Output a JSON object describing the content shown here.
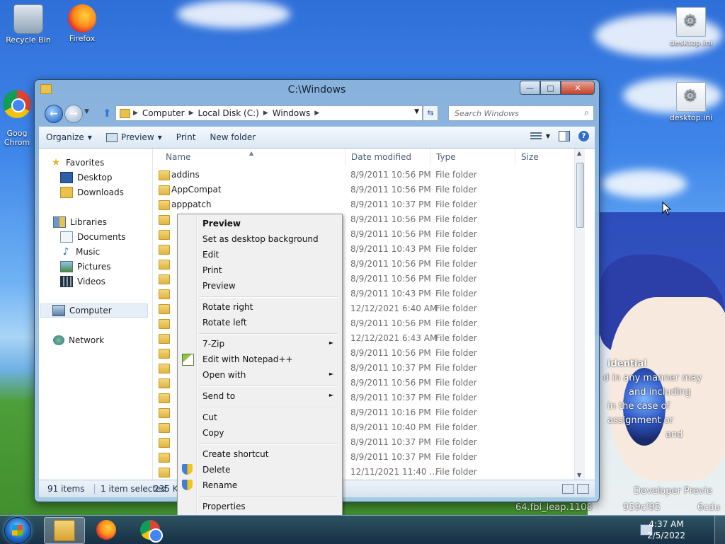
{
  "desktop": {
    "icons": [
      {
        "label": "Recycle Bin",
        "icon": "recycle-bin-icon"
      },
      {
        "label": "Firefox",
        "icon": "firefox-icon"
      },
      {
        "label": "Goog\nChrom",
        "icon": "chrome-icon"
      },
      {
        "label": "desktop.ini",
        "icon": "settings-file-icon"
      },
      {
        "label": "desktop.ini",
        "icon": "settings-file-icon"
      }
    ],
    "wallpaper_text": {
      "line1": "idential",
      "line2": "d in any manner may",
      "line3": "and including",
      "line4": "in the case of",
      "line5": "assignment or",
      "line6": "and",
      "preview": "Developer Previe",
      "build": "64.fbl_leap.1108",
      "build2": "959cf95",
      "build3": "6cdu"
    }
  },
  "window": {
    "title": "C:\\Windows",
    "caption_buttons": {
      "minimize": "—",
      "maximize": "□",
      "close": "✕"
    },
    "address": {
      "crumbs": [
        "Computer",
        "Local Disk (C:)",
        "Windows"
      ]
    },
    "search": {
      "placeholder": "Search Windows"
    },
    "toolbar": {
      "organize": "Organize",
      "preview": "Preview",
      "print": "Print",
      "new_folder": "New folder"
    },
    "nav": {
      "favorites": "Favorites",
      "desktop": "Desktop",
      "downloads": "Downloads",
      "libraries": "Libraries",
      "documents": "Documents",
      "music": "Music",
      "pictures": "Pictures",
      "videos": "Videos",
      "computer": "Computer",
      "network": "Network"
    },
    "columns": {
      "name": "Name",
      "date": "Date modified",
      "type": "Type",
      "size": "Size"
    },
    "rows": [
      {
        "name": "addins",
        "date": "8/9/2011 10:56 PM",
        "type": "File folder"
      },
      {
        "name": "AppCompat",
        "date": "8/9/2011 10:56 PM",
        "type": "File folder"
      },
      {
        "name": "apppatch",
        "date": "8/9/2011 10:37 PM",
        "type": "File folder"
      },
      {
        "name": "",
        "date": "8/9/2011 10:56 PM",
        "type": "File folder"
      },
      {
        "name": "",
        "date": "8/9/2011 10:56 PM",
        "type": "File folder"
      },
      {
        "name": "",
        "date": "8/9/2011 10:43 PM",
        "type": "File folder"
      },
      {
        "name": "",
        "date": "8/9/2011 10:56 PM",
        "type": "File folder"
      },
      {
        "name": "",
        "date": "8/9/2011 10:56 PM",
        "type": "File folder"
      },
      {
        "name": "",
        "date": "8/9/2011 10:43 PM",
        "type": "File folder"
      },
      {
        "name": "",
        "date": "12/12/2021 6:40 AM",
        "type": "File folder"
      },
      {
        "name": "",
        "date": "8/9/2011 10:56 PM",
        "type": "File folder"
      },
      {
        "name": "",
        "date": "12/12/2021 6:43 AM",
        "type": "File folder"
      },
      {
        "name": "",
        "date": "8/9/2011 10:56 PM",
        "type": "File folder"
      },
      {
        "name": "",
        "date": "8/9/2011 10:37 PM",
        "type": "File folder"
      },
      {
        "name": "",
        "date": "8/9/2011 10:56 PM",
        "type": "File folder"
      },
      {
        "name": "",
        "date": "8/9/2011 10:37 PM",
        "type": "File folder"
      },
      {
        "name": "",
        "date": "8/9/2011 10:16 PM",
        "type": "File folder"
      },
      {
        "name": "",
        "date": "8/9/2011 10:40 PM",
        "type": "File folder"
      },
      {
        "name": "",
        "date": "8/9/2011 10:37 PM",
        "type": "File folder"
      },
      {
        "name": "",
        "date": "8/9/2011 10:37 PM",
        "type": "File folder"
      },
      {
        "name": "",
        "date": "12/11/2021 11:40 ...",
        "type": "File folder"
      }
    ],
    "status": {
      "count": "91 items",
      "selected": "1 item selected",
      "size": "235 KB"
    }
  },
  "context_menu": {
    "items": [
      {
        "label": "Preview",
        "bold": true
      },
      {
        "label": "Set as desktop background"
      },
      {
        "label": "Edit"
      },
      {
        "label": "Print"
      },
      {
        "label": "Preview"
      },
      {
        "label": "Rotate right"
      },
      {
        "label": "Rotate left"
      },
      {
        "label": "7-Zip"
      },
      {
        "label": "Edit with Notepad++"
      },
      {
        "label": "Open with"
      },
      {
        "label": "Send to"
      },
      {
        "label": "Cut"
      },
      {
        "label": "Copy"
      },
      {
        "label": "Create shortcut"
      },
      {
        "label": "Delete"
      },
      {
        "label": "Rename"
      },
      {
        "label": "Properties"
      }
    ],
    "submenu_arrow": "►"
  },
  "taskbar": {
    "clock_time": "4:37 AM",
    "clock_date": "2/5/2022"
  }
}
